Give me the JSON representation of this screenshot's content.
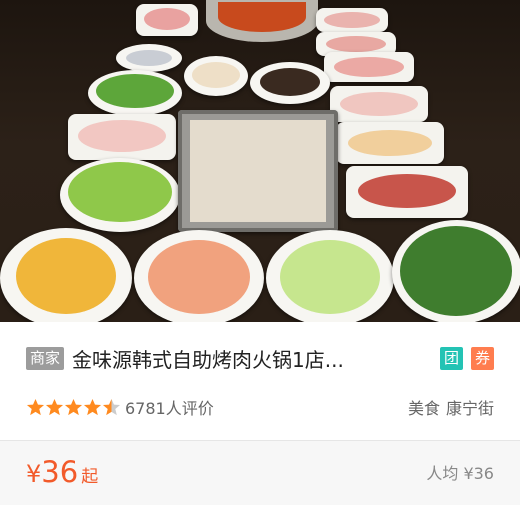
{
  "listing": {
    "image": {
      "alt_icon": "hotpot-bbq-buffet-photo"
    },
    "merchant_badge": "商家",
    "title": "金味源韩式自助烤肉火锅1店...",
    "tags": [
      {
        "label": "团",
        "icon": "group-buy-tag",
        "color": "#23c3b4"
      },
      {
        "label": "券",
        "icon": "coupon-tag",
        "color": "#ff7d4f"
      }
    ],
    "rating": {
      "stars": 4.5,
      "max_stars": 5,
      "review_count_text": "6781人评价"
    },
    "category": "美食",
    "area": "康宁街",
    "price": {
      "currency": "¥",
      "amount": "36",
      "suffix": "起"
    },
    "avg_price_text": "人均 ¥36"
  },
  "colors": {
    "accent": "#f25a2a",
    "star_on": "#ff8a1f",
    "star_off": "#cccccc"
  }
}
